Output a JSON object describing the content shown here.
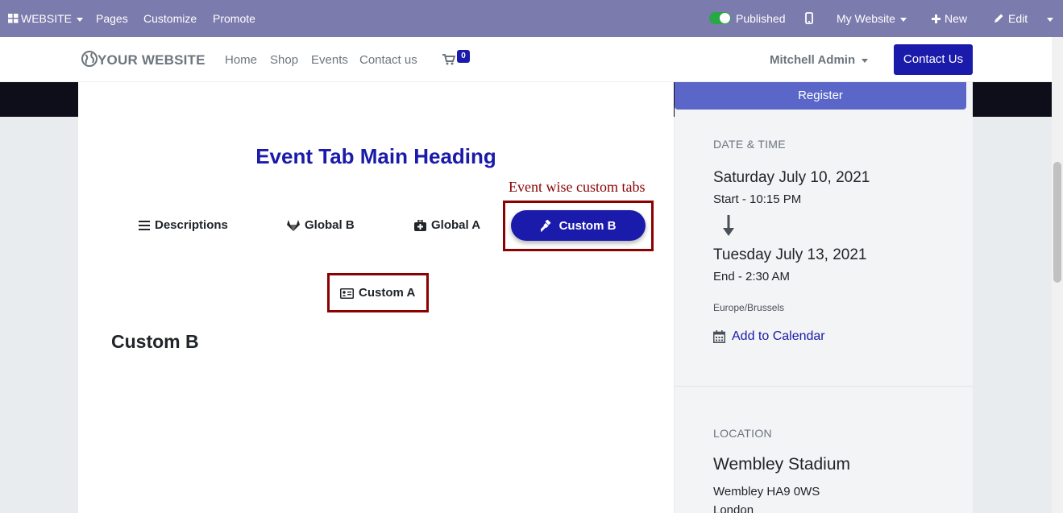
{
  "adminbar": {
    "website_label": "WEBSITE",
    "pages": "Pages",
    "customize": "Customize",
    "promote": "Promote",
    "published": "Published",
    "my_website": "My Website",
    "new": "New",
    "edit": "Edit"
  },
  "navbar": {
    "brand": "YOUR WEBSITE",
    "links": [
      "Home",
      "Shop",
      "Events",
      "Contact us"
    ],
    "cart_count": "0",
    "user": "Mitchell Admin",
    "contact_button": "Contact Us"
  },
  "main": {
    "heading": "Event Tab Main Heading",
    "annotation": "Event wise custom tabs",
    "tabs": [
      {
        "label": "Descriptions",
        "icon": "list-icon"
      },
      {
        "label": "Global B",
        "icon": "gitlab-icon"
      },
      {
        "label": "Global A",
        "icon": "medkit-icon"
      },
      {
        "label": "Custom B",
        "icon": "gavel-icon",
        "active": true
      },
      {
        "label": "Custom A",
        "icon": "id-card-icon"
      }
    ],
    "section_title": "Custom B"
  },
  "sidebar": {
    "register": "Register",
    "datetime_label": "DATE & TIME",
    "start_date": "Saturday July 10, 2021",
    "start_time": "Start - 10:15 PM",
    "end_date": "Tuesday July 13, 2021",
    "end_time": "End - 2:30 AM",
    "timezone": "Europe/Brussels",
    "add_to_calendar": "Add to Calendar",
    "location_label": "LOCATION",
    "venue": "Wembley Stadium",
    "address1": "Wembley HA9 0WS",
    "address2": "London"
  },
  "colors": {
    "admin_bar": "#7c7bad",
    "primary": "#1a1aab",
    "annotation": "#8b0000",
    "register": "#5a67c8"
  }
}
